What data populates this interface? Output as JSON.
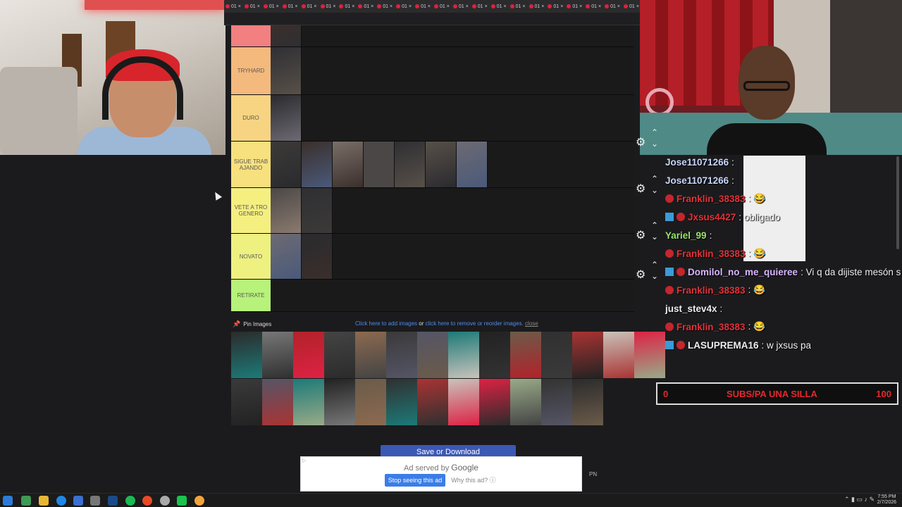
{
  "browser": {
    "tabs": [
      "01",
      "01",
      "01",
      "01",
      "01",
      "01",
      "01",
      "01",
      "01",
      "01",
      "01",
      "01",
      "01",
      "01",
      "01",
      "01",
      "01",
      "01",
      "01",
      "01",
      "01",
      "01"
    ]
  },
  "tierlist": {
    "tiers": [
      {
        "label": "",
        "color": "#f28080",
        "images": 1
      },
      {
        "label": "TRYHARD",
        "color": "#f4b97c",
        "images": 1
      },
      {
        "label": "DURO",
        "color": "#f7d482",
        "images": 1
      },
      {
        "label": "SIGUE TRABAJANDO",
        "color": "#f7e07e",
        "images": 7
      },
      {
        "label": "VETE A TRO GENERO",
        "color": "#f5ef80",
        "images": 2
      },
      {
        "label": "NOVATO",
        "color": "#eef17f",
        "images": 2
      },
      {
        "label": "RETIRATE",
        "color": "#b7f27a",
        "images": 0
      }
    ],
    "pin_label": "Pin Images",
    "links": {
      "add": "Click here to add images",
      "or": "or",
      "remove": "click here to remove or reorder images.",
      "close": "close"
    },
    "save_button": "Save or Download"
  },
  "ad": {
    "served_by": "Ad served by",
    "brand": "Google",
    "stop_label": "Stop seeing this ad",
    "why_label": "Why this ad?",
    "pn": "PN"
  },
  "chat": {
    "messages": [
      {
        "user": "Jose11071266",
        "text": ":",
        "color": "#c9d6ff"
      },
      {
        "user": "Jose11071266",
        "text": ":",
        "color": "#c9d6ff"
      },
      {
        "user": "Franklin_38383",
        "text": ": 😂",
        "color": "#e2323a",
        "badge": "red"
      },
      {
        "user": "Jxsus4427",
        "text": ": obligado",
        "color": "#e2323a",
        "badge": "both"
      },
      {
        "user": "Yariel_99",
        "text": ":",
        "color": "#9be46c"
      },
      {
        "user": "Franklin_38383",
        "text": ": 😂",
        "color": "#e2323a",
        "badge": "red"
      },
      {
        "user": "Domilol_no_me_quieree",
        "text": ": Vi q da dijiste mesón s",
        "color": "#d7b6ff",
        "badge": "both"
      },
      {
        "user": "Franklin_38383",
        "text": ": 😂",
        "color": "#e2323a",
        "badge": "red"
      },
      {
        "user": "just_stev4x",
        "text": ":",
        "color": "#eeeeee"
      },
      {
        "user": "Franklin_38383",
        "text": ": 😂",
        "color": "#e2323a",
        "badge": "red"
      },
      {
        "user": "LASUPREMA16",
        "text": ": w jxsus pa",
        "color": "#eeeeee",
        "badge": "both"
      }
    ]
  },
  "goal": {
    "start": "0",
    "label": "SUBS/PA UNA SILLA",
    "end": "100"
  },
  "taskbar": {
    "time": "7:55 PM",
    "date": "2/7/2026"
  }
}
